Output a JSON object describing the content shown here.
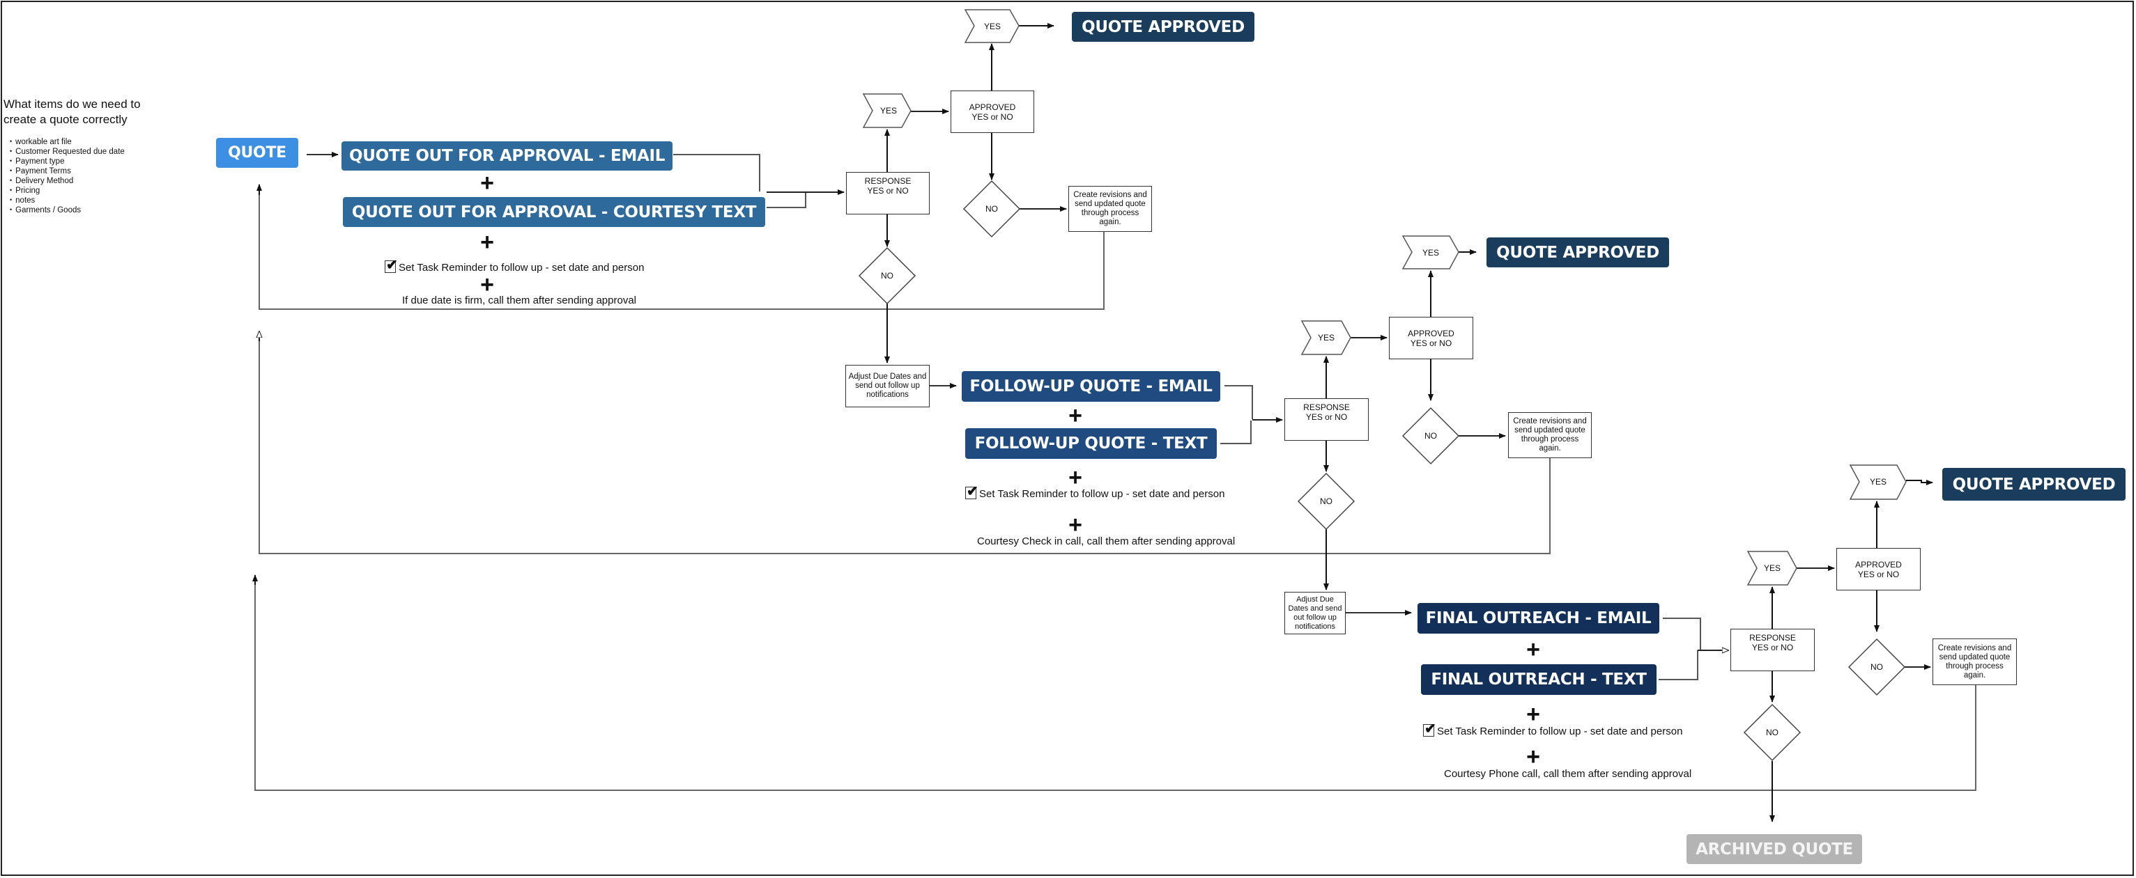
{
  "sidebar": {
    "title_line1": "What items do we need to",
    "title_line2": "create a quote correctly",
    "items": [
      "workable art file",
      "Customer Requested due date",
      "Payment type",
      "Payment Terms",
      "Delivery Method",
      "Pricing",
      "notes",
      "Garments / Goods"
    ]
  },
  "start": {
    "label": "QUOTE"
  },
  "tier1": {
    "email": "QUOTE OUT FOR APPROVAL - EMAIL",
    "text": "QUOTE OUT FOR APPROVAL - COURTESY TEXT",
    "plus": "+",
    "reminder": "Set Task Reminder to follow up - set date and person",
    "extra": "If due date is firm, call them after sending approval",
    "response": [
      "RESPONSE",
      "YES or NO"
    ],
    "yes": "YES",
    "approved": [
      "APPROVED",
      "YES or NO"
    ],
    "yes_top": "YES",
    "approved_banner": "QUOTE APPROVED",
    "no_approved": "NO",
    "revisions": "Create revisions and send updated quote through process again.",
    "no_response": "NO"
  },
  "tier2": {
    "adjust": "Adjust Due Dates and send out follow up notifications",
    "email": "FOLLOW-UP QUOTE - EMAIL",
    "text": "FOLLOW-UP QUOTE - TEXT",
    "plus": "+",
    "reminder": "Set Task Reminder to follow up - set date and person",
    "extra": "Courtesy Check in call, call them after sending approval",
    "response": [
      "RESPONSE",
      "YES or NO"
    ],
    "yes": "YES",
    "approved": [
      "APPROVED",
      "YES or NO"
    ],
    "yes_top": "YES",
    "approved_banner": "QUOTE APPROVED",
    "no_approved": "NO",
    "revisions": "Create revisions and send updated quote through process again.",
    "no_response": "NO"
  },
  "tier3": {
    "adjust": "Adjust Due Dates and send out follow up notifications",
    "email": "FINAL OUTREACH - EMAIL",
    "text": "FINAL OUTREACH - TEXT",
    "plus": "+",
    "reminder": "Set Task Reminder to follow up - set date and person",
    "extra": "Courtesy Phone call, call them after sending approval",
    "response": [
      "RESPONSE",
      "YES or NO"
    ],
    "yes": "YES",
    "approved": [
      "APPROVED",
      "YES or NO"
    ],
    "yes_top": "YES",
    "approved_banner": "QUOTE APPROVED",
    "no_approved": "NO",
    "revisions": "Create revisions and send updated quote through process again.",
    "no_response": "NO"
  },
  "end": {
    "archived": "ARCHIVED QUOTE"
  },
  "checkmark_glyph": "✔",
  "colors": {
    "quote": "#3d8fe3",
    "tier1": "#2e6a9c",
    "tier2": "#1f4b80",
    "tier3": "#13305a",
    "approved": "#1a3d5e",
    "archived": "#b4b4b4"
  }
}
